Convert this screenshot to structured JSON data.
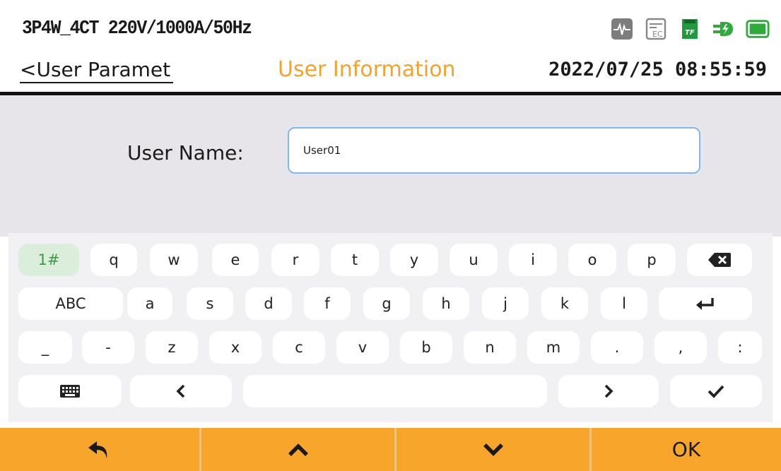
{
  "header": {
    "config": "3P4W_4CT 220V/1000A/50Hz",
    "back_label": "<User Paramet",
    "title": "User Information",
    "datetime": "2022/07/25 08:55:59",
    "status_icons": [
      "waveform-icon",
      "report-icon",
      "tf-card-icon",
      "power-plug-icon",
      "battery-icon"
    ],
    "title_color": "#f4a32a"
  },
  "form": {
    "user_name_label": "User Name:",
    "user_name_value": "User01"
  },
  "keyboard": {
    "row1": [
      "1#",
      "q",
      "w",
      "e",
      "r",
      "t",
      "y",
      "u",
      "i",
      "o",
      "p",
      "backspace"
    ],
    "row2": [
      "ABC",
      "a",
      "s",
      "d",
      "f",
      "g",
      "h",
      "j",
      "k",
      "l",
      "enter"
    ],
    "row3": [
      "_",
      "-",
      "z",
      "x",
      "c",
      "v",
      "b",
      "n",
      "m",
      ".",
      ",",
      ":"
    ],
    "row4": [
      "keyboard-hide",
      "<",
      "space",
      ">",
      "confirm"
    ]
  },
  "bottom_bar": {
    "ok_label": "OK",
    "color": "#f7a52b"
  }
}
